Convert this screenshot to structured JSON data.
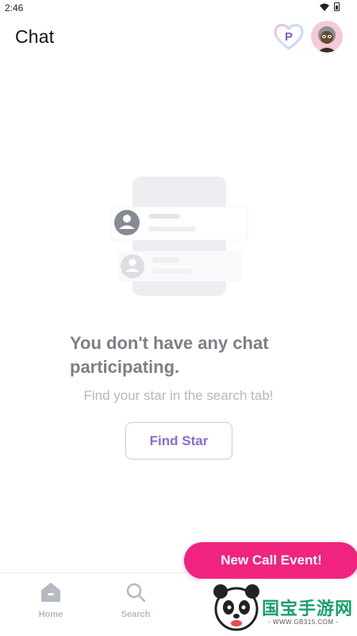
{
  "status_bar": {
    "time": "2:46",
    "icons": [
      "wifi-icon",
      "battery-icon"
    ]
  },
  "header": {
    "title": "Chat",
    "points_badge_letter": "P"
  },
  "empty_state": {
    "title": "You don't have any chat participating.",
    "subtitle": "Find your star in the search tab!",
    "button_label": "Find Star"
  },
  "event_button": {
    "label": "New Call Event!",
    "color": "#f0247e"
  },
  "bottom_nav": {
    "items": [
      {
        "label": "Home",
        "icon": "home-icon"
      },
      {
        "label": "Search",
        "icon": "search-icon"
      }
    ]
  },
  "watermark": {
    "text": "国宝手游网",
    "url": "- WWW.GB315.COM -"
  },
  "colors": {
    "accent_purple": "#8a6bd6",
    "muted_text": "#7b7f87",
    "event_pink": "#f0247e"
  }
}
